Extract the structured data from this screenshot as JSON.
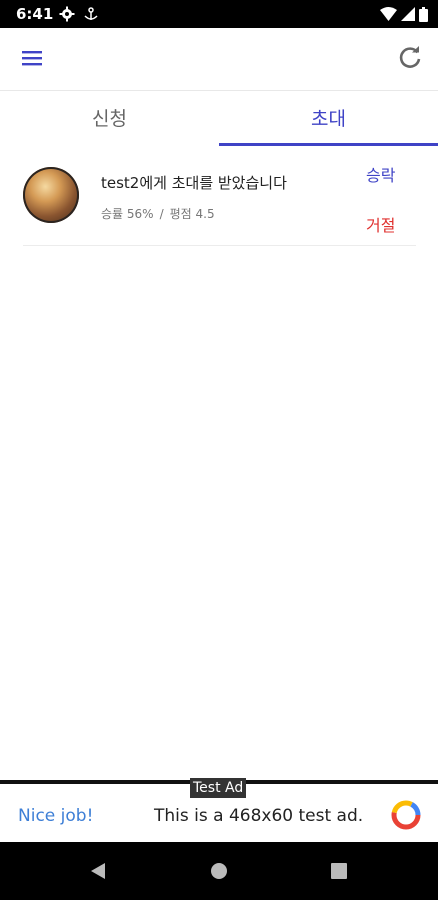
{
  "status_bar": {
    "time": "6:41"
  },
  "tabs": [
    {
      "label": "신청"
    },
    {
      "label": "초대"
    }
  ],
  "invite": {
    "message": "test2에게 초대를 받았습니다",
    "win_rate": "승률 56%",
    "separator": "/",
    "rating": "평점 4.5",
    "accept_label": "승락",
    "reject_label": "거절"
  },
  "ad": {
    "label": "Test Ad",
    "headline": "Nice job!",
    "body": "This is a 468x60 test ad."
  },
  "colors": {
    "accent": "#3f43c6",
    "reject": "#e0312f",
    "ad_link": "#3e7fd6"
  }
}
